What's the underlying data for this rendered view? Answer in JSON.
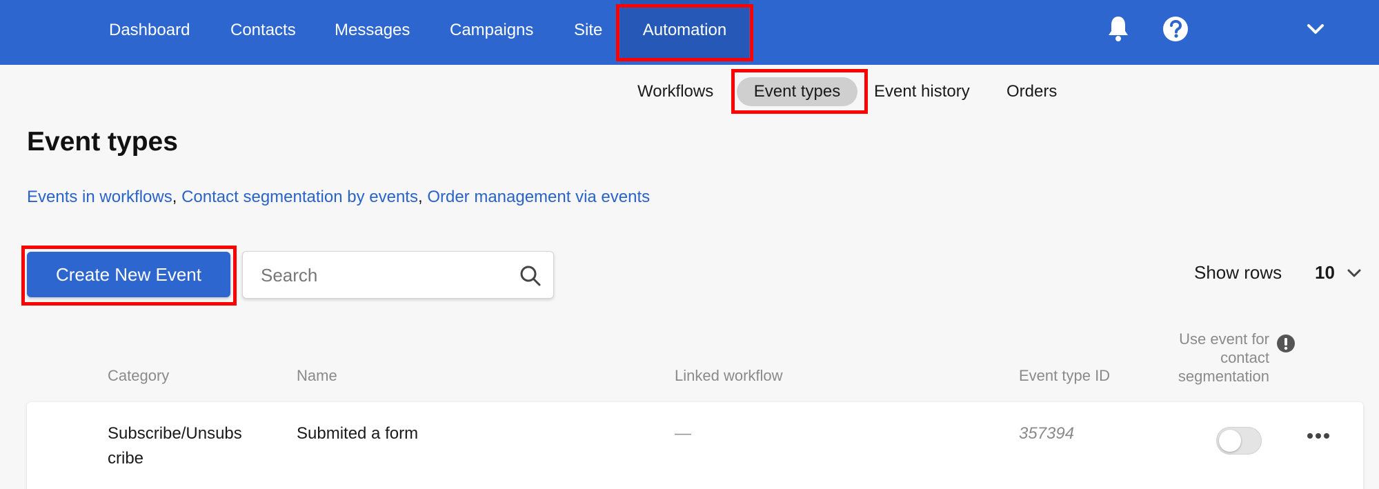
{
  "topnav": {
    "items": [
      {
        "label": "Dashboard"
      },
      {
        "label": "Contacts"
      },
      {
        "label": "Messages"
      },
      {
        "label": "Campaigns"
      },
      {
        "label": "Site"
      },
      {
        "label": "Automation",
        "active": true
      }
    ],
    "icons": [
      "bell-icon",
      "help-icon",
      "chevron-down-icon"
    ]
  },
  "subnav": {
    "items": [
      {
        "label": "Workflows"
      },
      {
        "label": "Event types",
        "active": true
      },
      {
        "label": "Event history"
      },
      {
        "label": "Orders"
      }
    ]
  },
  "page": {
    "title": "Event types",
    "help_links": [
      "Events in workflows",
      "Contact segmentation by events",
      "Order management via events"
    ],
    "link_separator": ","
  },
  "toolbar": {
    "create_label": "Create New Event",
    "search_placeholder": "Search",
    "show_rows_label": "Show rows",
    "show_rows_value": "10"
  },
  "table": {
    "columns": [
      "Category",
      "Name",
      "Linked workflow",
      "Event type ID",
      "Use event for contact segmentation"
    ],
    "rows": [
      {
        "category": "Subscribe/Unsubscribe",
        "name": "Submited a form",
        "linked_workflow": "—",
        "event_type_id": "357394",
        "segmentation_enabled": false
      }
    ]
  },
  "colors": {
    "primary": "#2c66ce",
    "highlight": "#ff0000",
    "link": "#2a63c7"
  }
}
